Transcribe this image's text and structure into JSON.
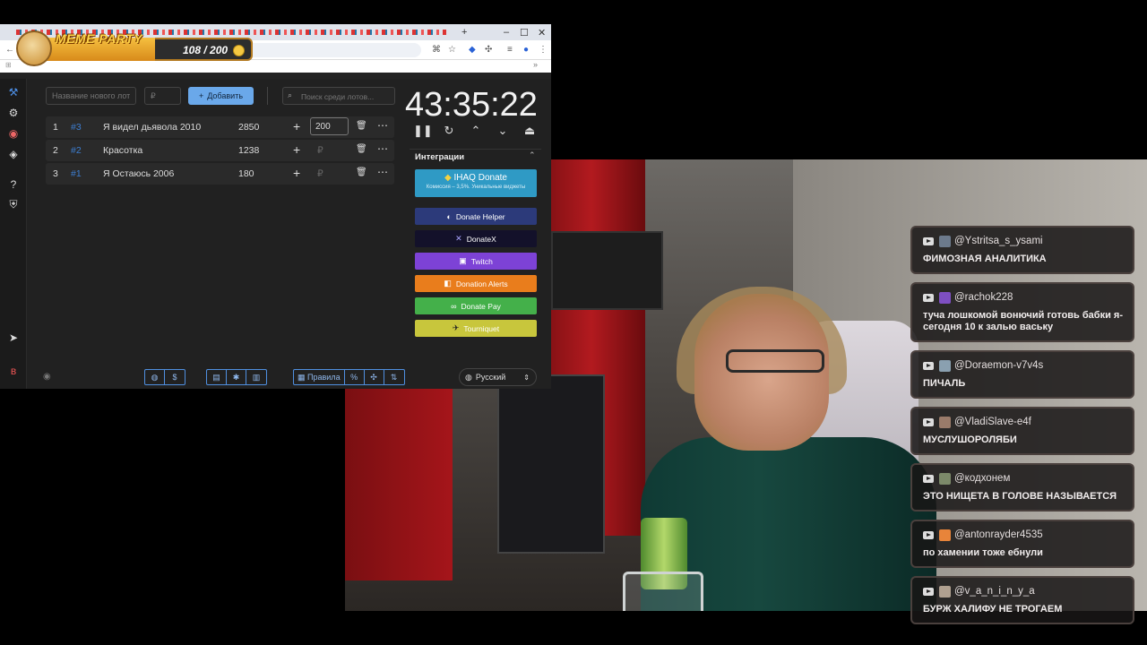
{
  "meme_party": {
    "title": "MEME PARTY",
    "count": "108 / 200",
    "progress": 0.54
  },
  "app": {
    "new_lot_placeholder": "Название нового лот",
    "amount_placeholder": "₽",
    "add_button_label": "Добавить",
    "search_placeholder": "Поиск среди лотов...",
    "lots": [
      {
        "num": "1",
        "hash": "#3",
        "name": "Я видел дьявола 2010",
        "amount": "2850",
        "value": "200"
      },
      {
        "num": "2",
        "hash": "#2",
        "name": "Красотка",
        "amount": "1238",
        "value": "₽"
      },
      {
        "num": "3",
        "hash": "#1",
        "name": "Я Остаюсь 2006",
        "amount": "180",
        "value": "₽"
      }
    ],
    "timer": "43:35:22",
    "integrations": {
      "title": "Интеграции",
      "ihaq": {
        "name": "IHAQ Donate",
        "sub": "Комиссия – 3,5%. Уникальные виджеты"
      },
      "buttons": [
        {
          "label": "Donate Helper",
          "icon": "donate-helper-icon",
          "color": "#2c3a7a"
        },
        {
          "label": "DonateX",
          "icon": "donatex-icon",
          "color": "#13112a"
        },
        {
          "label": "Twitch",
          "icon": "twitch-icon",
          "color": "#7d42d6"
        },
        {
          "label": "Donation Alerts",
          "icon": "donation-alerts-icon",
          "color": "#e97d1c"
        },
        {
          "label": "Donate Pay",
          "icon": "donate-pay-icon",
          "color": "#44b04a"
        },
        {
          "label": "Tourniquet",
          "icon": "tourniquet-icon",
          "color": "#c8c63c"
        }
      ]
    },
    "bottom": {
      "rules_label": "Правила",
      "language": "Русский"
    }
  },
  "chat": [
    {
      "user": "@Ystritsa_s_ysami",
      "text": "ФИМОЗНАЯ АНАЛИТИКА"
    },
    {
      "user": "@rachok228",
      "text": "туча лошкомой вонючий готовь бабки я-сегодня 10 к залью ваську"
    },
    {
      "user": "@Doraemon-v7v4s",
      "text": "ПИЧАЛЬ"
    },
    {
      "user": "@VladiSlave-e4f",
      "text": "МУСЛУШОРОЛЯБИ"
    },
    {
      "user": "@кодхонем",
      "text": "ЭТО НИЩЕТА В ГОЛОВЕ НАЗЫВАЕТСЯ"
    },
    {
      "user": "@antonrayder4535",
      "text": "по хамении тоже ебнули"
    },
    {
      "user": "@v_a_n_i_n_y_a",
      "text": "БУРЖ ХАЛИФУ НЕ ТРОГАЕМ"
    }
  ]
}
